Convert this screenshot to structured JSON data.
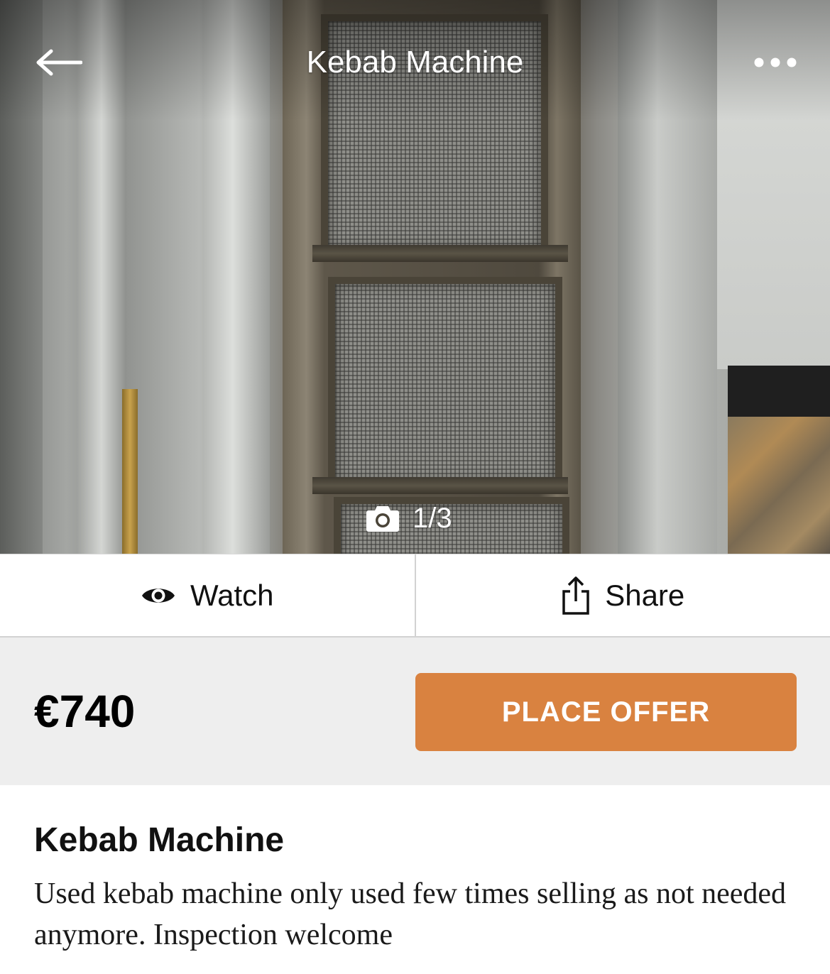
{
  "header": {
    "title": "Kebab Machine",
    "back_icon": "arrow-left-icon",
    "more_icon": "more-dots-icon"
  },
  "gallery": {
    "counter": "1/3",
    "counter_icon": "camera-icon",
    "current_index": 1,
    "total": 3
  },
  "actions": {
    "watch_label": "Watch",
    "watch_icon": "eye-icon",
    "share_label": "Share",
    "share_icon": "share-icon"
  },
  "listing": {
    "price": "€740",
    "offer_button": "PLACE OFFER",
    "title": "Kebab Machine",
    "description": "Used kebab machine only used few times selling as not needed anymore. Inspection welcome"
  },
  "colors": {
    "accent": "#d98240",
    "price_bar_bg": "#eeeeee"
  }
}
